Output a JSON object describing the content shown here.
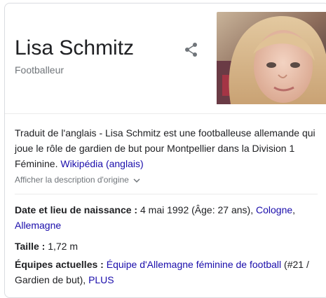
{
  "entity": {
    "title": "Lisa Schmitz",
    "subtitle": "Footballeur"
  },
  "share_icon": "share-icon",
  "description": {
    "text": "Traduit de l'anglais - Lisa Schmitz est une footballeuse allemande qui joue le rôle de gardien de but pour Montpellier dans la Division 1 Féminine.",
    "source_link": "Wikipédia (anglais)",
    "show_original": "Afficher la description d'origine"
  },
  "facts": {
    "birth": {
      "label": "Date et lieu de naissance",
      "sep": " : ",
      "value": "4 mai 1992 (Âge: 27 ans), ",
      "link1": "Cologne",
      "comma": ",",
      "link2": "Allemagne"
    },
    "height": {
      "label": "Taille",
      "sep": " : ",
      "value": "1,72 m"
    },
    "teams": {
      "label": "Équipes actuelles",
      "sep": " : ",
      "link1": "Équipe d'Allemagne féminine de football",
      "value": " (#21 / Gardien de but), ",
      "more": "PLUS"
    }
  },
  "colors": {
    "link": "#1a0dab",
    "secondary_text": "#70757a",
    "border": "#dadce0"
  }
}
